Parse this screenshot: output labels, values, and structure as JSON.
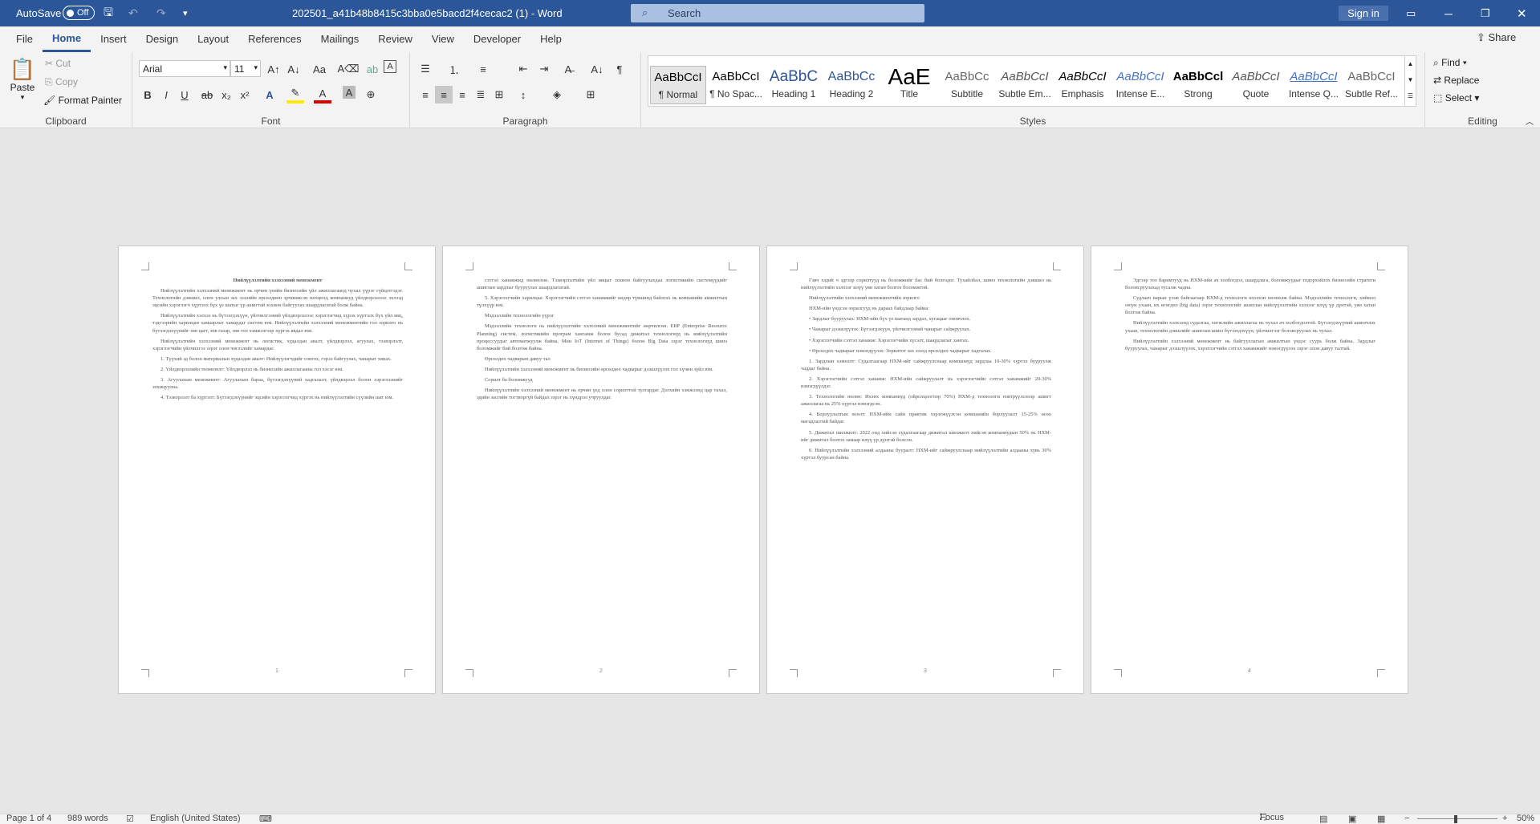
{
  "title_bar": {
    "autosave_label": "AutoSave",
    "autosave_state": "Off",
    "doc_title": "202501_a41b48b8415c3bba0e5bacd2f4cecac2 (1)  -  Word",
    "search_placeholder": "Search",
    "sign_in": "Sign in"
  },
  "tabs": [
    "File",
    "Home",
    "Insert",
    "Design",
    "Layout",
    "References",
    "Mailings",
    "Review",
    "View",
    "Developer",
    "Help"
  ],
  "active_tab": "Home",
  "share_label": "Share",
  "clipboard": {
    "paste": "Paste",
    "cut": "Cut",
    "copy": "Copy",
    "format_painter": "Format Painter",
    "label": "Clipboard"
  },
  "font": {
    "name": "Arial",
    "size": "11",
    "label": "Font"
  },
  "paragraph": {
    "label": "Paragraph"
  },
  "styles": {
    "label": "Styles",
    "items": [
      {
        "preview": "AaBbCcI",
        "name": "¶ Normal"
      },
      {
        "preview": "AaBbCcI",
        "name": "¶ No Spac..."
      },
      {
        "preview": "AaBbC",
        "name": "Heading 1"
      },
      {
        "preview": "AaBbCc",
        "name": "Heading 2"
      },
      {
        "preview": "AaE",
        "name": "Title"
      },
      {
        "preview": "AaBbCc",
        "name": "Subtitle"
      },
      {
        "preview": "AaBbCcI",
        "name": "Subtle Em..."
      },
      {
        "preview": "AaBbCcI",
        "name": "Emphasis"
      },
      {
        "preview": "AaBbCcI",
        "name": "Intense E..."
      },
      {
        "preview": "AaBbCcl",
        "name": "Strong"
      },
      {
        "preview": "AaBbCcI",
        "name": "Quote"
      },
      {
        "preview": "AaBbCcI",
        "name": "Intense Q..."
      },
      {
        "preview": "AaBbCcI",
        "name": "Subtle Ref..."
      }
    ]
  },
  "editing": {
    "find": "Find",
    "replace": "Replace",
    "select": "Select",
    "label": "Editing"
  },
  "pages": [
    {
      "number": "1",
      "title": "Нийлүүлэлтийн хэлхээний менежмент",
      "paragraphs": [
        "Нийлүүлэлтийн хэлхээний менежмент нь орчин үеийн бизнесийн үйл ажиллагаанд чухал үүрэг гүйцэтгэдэг. Технологийн дэвшил, олон улсын зах зээлийн өрсөлдөөн эрчимжсэн нөхцөлд компаниуд үйлдвэрлэлээс эхлээд эцсийн хэрэглэгч хүртэлх бүх үе шатыг үр ашигтай зохион байгуулах шаардлагатай болж байна.",
        "Нийлүүлэлтийн хэлхээ нь бүтээгдэхүүн, үйлчилгээний үйлдвэрлэлээс хэрэглэгчид хүрэх хүртэлх бүх үйл явц, тэдгээрийн харилцан хамаарлыг хамардаг систем юм. Нийлүүлэлтийн хэлхээний менежментийн гол зорилго нь бүтээгдэхүүнийг зөв цагт, зөв газар, зөв тоо хэмжээгээр хүргэх явдал юм.",
        "Нийлүүлэлтийн хэлхээний менежмент нь логистик, худалдан авалт, үйлдвэрлэл, агуулах, тээвэрлэлт, хэрэглэгчийн үйлчилгээ зэрэг олон чиглэлийг хамардаг.",
        "1. Түүхий эд болон материалын худалдан авалт: Нийлүүлэгчдийг сонгох, гэрээ байгуулах, чанарыг хянах.",
        "2. Үйлдвэрлэлийн төлөвлөлт: Үйлдвэрлэл нь бизнесийн ажиллагааны гол хэсэг юм.",
        "3. Агуулахын менежмент: Агуулахын бараа, бүтээгдэхүүний хадгалалт, үйлдвэрлэл болон хэрэглээнийг зохицуулна.",
        "4. Тээвэрлэлт ба хүргэлт: Бүтээгдэхүүнийг эцсийн хэрэглэгчид хүргэх нь нийлүүлэлтийн сүүлийн шат юм."
      ]
    },
    {
      "number": "2",
      "title": "",
      "paragraphs": [
        "сэтгэл ханамжид нөлөөлнө. Тээвэрлэлтийн үйл явцыг зохион байгуулахдаа логистикийн системүүдийг ашиглан зардлыг бууруулах шаардлагатай.",
        "5. Хэрэглэгчийн харилцаа: Хэрэглэгчийн сэтгэл ханамжийг өндөр түвшинд байлгах нь компанийн амжилтын түлхүүр юм.",
        "Мэдээллийн технологийн үүрэг",
        "Мэдээллийн технологи нь нийлүүлэлтийн хэлхээний менежментийг өөрчилсөн. ERP (Enterprise Resource Planning) систем, логистикийн програм хангамж болон бусад дижитал технологиуд нь нийлүүлэлтийн процессуудыг автоматжуулж байна. Мөн IoT (Internet of Things) болон Big Data зэрэг технологиуд шинэ боломжийг бий болгож байна.",
        "Өрсөлдөх чадварын давуу тал",
        "Нийлүүлэлтийн хэлхээний менежмент нь бизнесийн өрсөлдөх чадварыг дээшлүүлэх гол хүчин зүйл юм.",
        "Сорилт ба боломжууд",
        "Нийлүүлэлтийн хэлхээний менежмент нь орчин үед олон сорилттой тулгардаг. Дэлхийн хэмжээнд цар тахал, эдийн засгийн тогтворгүй байдал зэрэг нь хүндрэл учруулдаг."
      ]
    },
    {
      "number": "3",
      "title": "",
      "paragraphs": [
        "Гэвч хэдий ч эдгээр сорилтууд нь боломжийг бас бий болгодог. Тухайлбал, шинэ технологийн дэвшил нь нийлүүлэлтийн хэлхээг илүү уян хатан болгох боломжтой.",
        "Нийлүүлэлтийн хэлхээний менежментийн зорилго",
        "НХМ-ийн үндсэн зорилгууд нь дараах байдлаар байна:",
        "• Зардлыг бууруулах: НХМ-ийн бүх үе шатанд зардал, хугацааг оновчлох.",
        "• Чанарыг дээшлүүлэх: Бүтээгдэхүүн, үйлчилгээний чанарыг сайжруулах.",
        "• Хэрэглэгчийн сэтгэл ханамж: Хэрэглэгчийн хүсэлт, шаардлагыг хангах.",
        "• Өрсөлдөх чадварыг нэмэгдүүлэх: Зорилтот зах зээлд өрсөлдөх чадварыг хадгалах.",
        "1. Зардлын хэмнэлт: Судалгаагаар НХМ-ийг сайжруулснаар компаниуд зардлаа 10-30% хүртэл бууруулж чаддаг байна.",
        "2. Хэрэглэгчийн сэтгэл ханамж: НХМ-ийн сайжруулалт нь хэрэглэгчийн сэтгэл ханамжийг 20-30% нэмэгдүүлдэг.",
        "3. Технологийн нөлөө: Ихэнх компаниуд (ойролцоогоор 70%) НХМ-д технологи нэвтрүүлснээр ашигт ажиллагаа нь 25% хүртэл нэмэгдсэн.",
        "4. Борлуулалтын өсөлт: НХМ-ийн сайн практик хэрэгжүүлсэн компанийн борлуулалт 15-25% өсөх магадлалтай байдаг.",
        "5. Дижитал шилжилт: 2022 онд хийсэн судалгаагаар дижитал шилжилт хийсэн компаниудын 50% нь НХМ-ийг дижитал болгох замаар илүү үр дүнтэй болсон.",
        "6. Нийлүүлэлтийн хэлхээний алдааны бууралт: НХМ-ийг сайжруулснаар нийлүүлэлтийн алдааны хувь 30% хүртэл буурсан байна."
      ]
    },
    {
      "number": "4",
      "title": "",
      "paragraphs": [
        "Эдгээр тоо баримтууд нь НХМ-ийн ач холбогдол, шаардлага, боломжуудыг тодорхойлох бизнесийн стратеги боловсруулахад тусалж чадна.",
        "Судлаач нарын үзэж байгаагаар НХМ-д технологи ихээхэн нөлөөлж байна. Мэдээллийн технологи, хиймэл оюун ухаан, их өгөгдөл (big data) зэрэг технологийг ашиглан нийлүүлэлтийн хэлхээг илүү үр дүнтэй, уян хатан болгож байна.",
        "Нийлүүлэлтийн хэлхээнд судалгаа, хөгжлийн ажиллагаа нь чухал ач холбогдолтой. Бүтээгдэхүүний шинэчлэх ухаан, технологийн дэвшлийг ашиглан шинэ бүтээгдэхүүн, үйлчилгээг боловсруулах нь чухал.",
        "Нийлүүлэлтийн хэлхээний менежмент нь байгууллагын амжилтын үндэс суурь болж байна. Зардлыг бууруулах, чанарыг дээшлүүлэх, хэрэглэгчийн сэтгэл ханамжийг нэмэгдүүлэх зэрэг олон давуу талтай."
      ]
    }
  ],
  "status": {
    "page": "Page 1 of 4",
    "words": "989 words",
    "language": "English (United States)",
    "focus": "Focus",
    "zoom": "50%"
  }
}
